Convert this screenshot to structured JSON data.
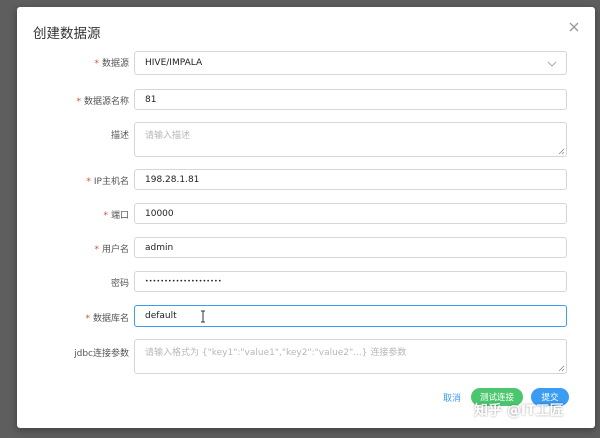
{
  "dialog": {
    "title": "创建数据源"
  },
  "form": {
    "datasource_type": {
      "label": "数据源",
      "required": true,
      "value": "HIVE/IMPALA"
    },
    "datasource_name": {
      "label": "数据源名称",
      "required": true,
      "value": "81"
    },
    "description": {
      "label": "描述",
      "required": false,
      "placeholder": "请输入描述"
    },
    "ip_hostname": {
      "label": "IP主机名",
      "required": true,
      "value": "198.28.1.81"
    },
    "port": {
      "label": "端口",
      "required": true,
      "value": "10000"
    },
    "username": {
      "label": "用户名",
      "required": true,
      "value": "admin"
    },
    "password": {
      "label": "密码",
      "required": false,
      "value": "••••••••••••••••••••"
    },
    "database_name": {
      "label": "数据库名",
      "required": true,
      "value": "default"
    },
    "jdbc_params": {
      "label": "jdbc连接参数",
      "required": false,
      "placeholder": "请输入格式为 {\"key1\":\"value1\",\"key2\":\"value2\"...} 连接参数"
    }
  },
  "actions": {
    "cancel_label": "取消",
    "test_label": "测试连接",
    "submit_label": "提交"
  },
  "watermark": "知乎 @IT工匠",
  "colors": {
    "primary": "#3a9cf2",
    "success": "#4cc66e",
    "required": "#e6473a",
    "overlay": "#5e5e5e"
  },
  "icons": {
    "close": "close-icon",
    "dropdown": "chevron-down-icon",
    "resize": "resize-handle-icon",
    "text_cursor": "text-cursor-icon"
  }
}
